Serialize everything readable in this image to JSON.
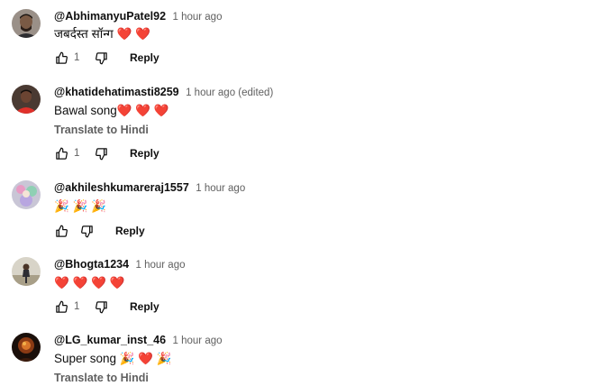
{
  "comments": [
    {
      "author": "@AbhimanyuPatel92",
      "time": "1 hour ago",
      "text": "जबर्दस्त सॉन्ग ❤️ ❤️",
      "translate": "",
      "likes": "1",
      "reply_label": "Reply"
    },
    {
      "author": "@khatidehatimasti8259",
      "time": "1 hour ago (edited)",
      "text": "Bawal  song❤️ ❤️ ❤️",
      "translate": "Translate to Hindi",
      "likes": "1",
      "reply_label": "Reply"
    },
    {
      "author": "@akhileshkumareraj1557",
      "time": "1 hour ago",
      "text": "🎉 🎉 🎉",
      "translate": "",
      "likes": "",
      "reply_label": "Reply"
    },
    {
      "author": "@Bhogta1234",
      "time": "1 hour ago",
      "text": "❤️ ❤️ ❤️ ❤️",
      "translate": "",
      "likes": "1",
      "reply_label": "Reply"
    },
    {
      "author": "@LG_kumar_inst_46",
      "time": "1 hour ago",
      "text": "Super song 🎉 ❤️ 🎉",
      "translate": "Translate to Hindi",
      "likes": "",
      "reply_label": ""
    }
  ],
  "icons": {
    "like": "thumb-up-icon",
    "dislike": "thumb-down-icon"
  },
  "colors": {
    "text_primary": "#0f0f0f",
    "text_secondary": "#606060",
    "heart": "#e0263c"
  }
}
